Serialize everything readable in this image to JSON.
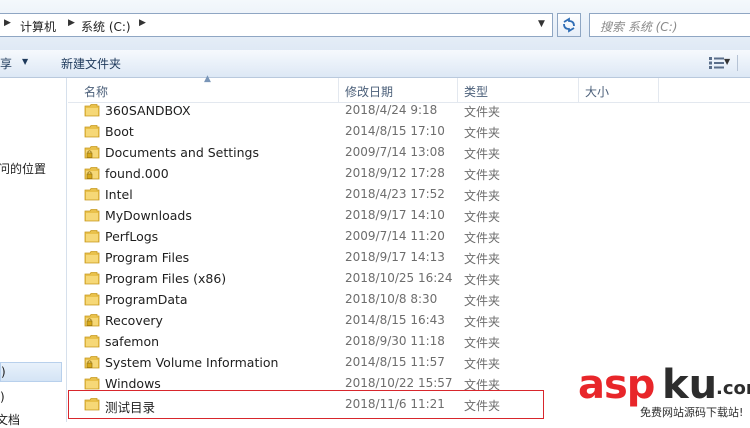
{
  "address_bar": {
    "breadcrumbs": [
      "计算机",
      "系统 (C:)"
    ],
    "search_placeholder": "搜索 系统 (C:)"
  },
  "toolbar": {
    "share_label": "共享",
    "new_folder_label": "新建文件夹"
  },
  "nav_pane": {
    "items": [
      "问的位置",
      ":)",
      ":)",
      "文档"
    ]
  },
  "columns": {
    "name": "名称",
    "modified": "修改日期",
    "type": "类型",
    "size": "大小"
  },
  "files": [
    {
      "name": "360SANDBOX",
      "date": "2018/4/24 9:18",
      "type": "文件夹",
      "locked": false
    },
    {
      "name": "Boot",
      "date": "2014/8/15 17:10",
      "type": "文件夹",
      "locked": false
    },
    {
      "name": "Documents and Settings",
      "date": "2009/7/14 13:08",
      "type": "文件夹",
      "locked": true
    },
    {
      "name": "found.000",
      "date": "2018/9/12 17:28",
      "type": "文件夹",
      "locked": true
    },
    {
      "name": "Intel",
      "date": "2018/4/23 17:52",
      "type": "文件夹",
      "locked": false
    },
    {
      "name": "MyDownloads",
      "date": "2018/9/17 14:10",
      "type": "文件夹",
      "locked": false
    },
    {
      "name": "PerfLogs",
      "date": "2009/7/14 11:20",
      "type": "文件夹",
      "locked": false
    },
    {
      "name": "Program Files",
      "date": "2018/9/17 14:13",
      "type": "文件夹",
      "locked": false
    },
    {
      "name": "Program Files (x86)",
      "date": "2018/10/25 16:24",
      "type": "文件夹",
      "locked": false
    },
    {
      "name": "ProgramData",
      "date": "2018/10/8 8:30",
      "type": "文件夹",
      "locked": false
    },
    {
      "name": "Recovery",
      "date": "2014/8/15 16:43",
      "type": "文件夹",
      "locked": true
    },
    {
      "name": "safemon",
      "date": "2018/9/30 11:18",
      "type": "文件夹",
      "locked": false
    },
    {
      "name": "System Volume Information",
      "date": "2014/8/15 11:57",
      "type": "文件夹",
      "locked": true
    },
    {
      "name": "Windows",
      "date": "2018/10/22 15:57",
      "type": "文件夹",
      "locked": false
    },
    {
      "name": "测试目录",
      "date": "2018/11/6 11:21",
      "type": "文件夹",
      "locked": false
    }
  ],
  "watermark": {
    "brand_a": "asp",
    "brand_b": "ku",
    "brand_c": ".com",
    "subtitle": "免费网站源码下载站!"
  },
  "colors": {
    "highlight_border": "#d8262c",
    "folder_yellow": "#f0c94a"
  }
}
